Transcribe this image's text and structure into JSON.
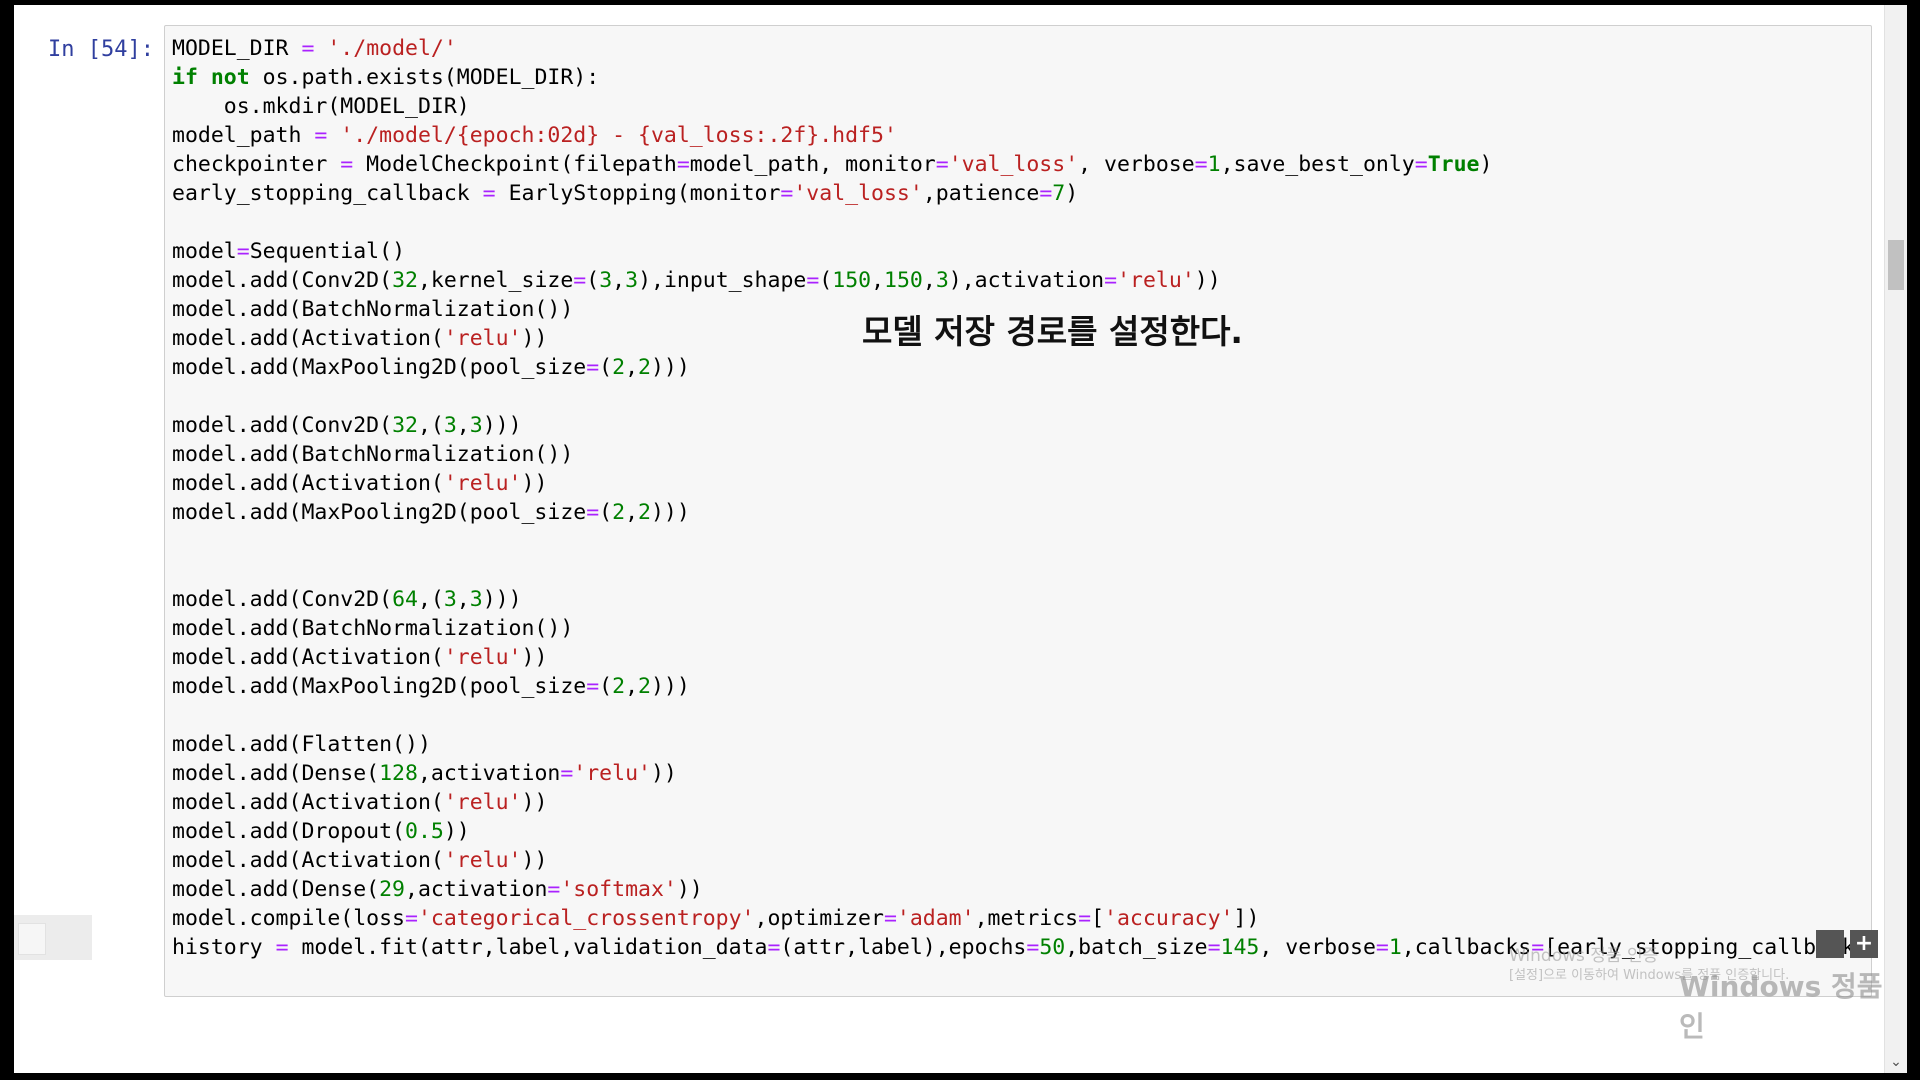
{
  "cell": {
    "prompt": "In [54]:",
    "lines": [
      [
        {
          "t": "MODEL_DIR "
        },
        {
          "t": "=",
          "c": "o"
        },
        {
          "t": " "
        },
        {
          "t": "'./model/'",
          "c": "s"
        }
      ],
      [
        {
          "t": "if",
          "c": "k"
        },
        {
          "t": " "
        },
        {
          "t": "not",
          "c": "k"
        },
        {
          "t": " os.path.exists(MODEL_DIR):"
        }
      ],
      [
        {
          "t": "    os.mkdir(MODEL_DIR)"
        }
      ],
      [
        {
          "t": "model_path "
        },
        {
          "t": "=",
          "c": "o"
        },
        {
          "t": " "
        },
        {
          "t": "'./model/{epoch:02d} - {val_loss:.2f}.hdf5'",
          "c": "s"
        }
      ],
      [
        {
          "t": "checkpointer "
        },
        {
          "t": "=",
          "c": "o"
        },
        {
          "t": " ModelCheckpoint(filepath"
        },
        {
          "t": "=",
          "c": "o"
        },
        {
          "t": "model_path, monitor"
        },
        {
          "t": "=",
          "c": "o"
        },
        {
          "t": "'val_loss'",
          "c": "s"
        },
        {
          "t": ", verbose"
        },
        {
          "t": "=",
          "c": "o"
        },
        {
          "t": "1",
          "c": "n"
        },
        {
          "t": ",save_best_only"
        },
        {
          "t": "=",
          "c": "o"
        },
        {
          "t": "True",
          "c": "k"
        },
        {
          "t": ")"
        }
      ],
      [
        {
          "t": "early_stopping_callback "
        },
        {
          "t": "=",
          "c": "o"
        },
        {
          "t": " EarlyStopping(monitor"
        },
        {
          "t": "=",
          "c": "o"
        },
        {
          "t": "'val_loss'",
          "c": "s"
        },
        {
          "t": ",patience"
        },
        {
          "t": "=",
          "c": "o"
        },
        {
          "t": "7",
          "c": "n"
        },
        {
          "t": ")"
        }
      ],
      [],
      [
        {
          "t": "model"
        },
        {
          "t": "=",
          "c": "o"
        },
        {
          "t": "Sequential()"
        }
      ],
      [
        {
          "t": "model.add(Conv2D("
        },
        {
          "t": "32",
          "c": "n"
        },
        {
          "t": ",kernel_size"
        },
        {
          "t": "=",
          "c": "o"
        },
        {
          "t": "("
        },
        {
          "t": "3",
          "c": "n"
        },
        {
          "t": ","
        },
        {
          "t": "3",
          "c": "n"
        },
        {
          "t": "),input_shape"
        },
        {
          "t": "=",
          "c": "o"
        },
        {
          "t": "("
        },
        {
          "t": "150",
          "c": "n"
        },
        {
          "t": ","
        },
        {
          "t": "150",
          "c": "n"
        },
        {
          "t": ","
        },
        {
          "t": "3",
          "c": "n"
        },
        {
          "t": "),activation"
        },
        {
          "t": "=",
          "c": "o"
        },
        {
          "t": "'relu'",
          "c": "s"
        },
        {
          "t": "))"
        }
      ],
      [
        {
          "t": "model.add(BatchNormalization())"
        }
      ],
      [
        {
          "t": "model.add(Activation("
        },
        {
          "t": "'relu'",
          "c": "s"
        },
        {
          "t": "))"
        }
      ],
      [
        {
          "t": "model.add(MaxPooling2D(pool_size"
        },
        {
          "t": "=",
          "c": "o"
        },
        {
          "t": "("
        },
        {
          "t": "2",
          "c": "n"
        },
        {
          "t": ","
        },
        {
          "t": "2",
          "c": "n"
        },
        {
          "t": ")))"
        }
      ],
      [],
      [
        {
          "t": "model.add(Conv2D("
        },
        {
          "t": "32",
          "c": "n"
        },
        {
          "t": ",("
        },
        {
          "t": "3",
          "c": "n"
        },
        {
          "t": ","
        },
        {
          "t": "3",
          "c": "n"
        },
        {
          "t": ")))"
        }
      ],
      [
        {
          "t": "model.add(BatchNormalization())"
        }
      ],
      [
        {
          "t": "model.add(Activation("
        },
        {
          "t": "'relu'",
          "c": "s"
        },
        {
          "t": "))"
        }
      ],
      [
        {
          "t": "model.add(MaxPooling2D(pool_size"
        },
        {
          "t": "=",
          "c": "o"
        },
        {
          "t": "("
        },
        {
          "t": "2",
          "c": "n"
        },
        {
          "t": ","
        },
        {
          "t": "2",
          "c": "n"
        },
        {
          "t": ")))"
        }
      ],
      [],
      [],
      [
        {
          "t": "model.add(Conv2D("
        },
        {
          "t": "64",
          "c": "n"
        },
        {
          "t": ",("
        },
        {
          "t": "3",
          "c": "n"
        },
        {
          "t": ","
        },
        {
          "t": "3",
          "c": "n"
        },
        {
          "t": ")))"
        }
      ],
      [
        {
          "t": "model.add(BatchNormalization())"
        }
      ],
      [
        {
          "t": "model.add(Activation("
        },
        {
          "t": "'relu'",
          "c": "s"
        },
        {
          "t": "))"
        }
      ],
      [
        {
          "t": "model.add(MaxPooling2D(pool_size"
        },
        {
          "t": "=",
          "c": "o"
        },
        {
          "t": "("
        },
        {
          "t": "2",
          "c": "n"
        },
        {
          "t": ","
        },
        {
          "t": "2",
          "c": "n"
        },
        {
          "t": ")))"
        }
      ],
      [],
      [
        {
          "t": "model.add(Flatten())"
        }
      ],
      [
        {
          "t": "model.add(Dense("
        },
        {
          "t": "128",
          "c": "n"
        },
        {
          "t": ",activation"
        },
        {
          "t": "=",
          "c": "o"
        },
        {
          "t": "'relu'",
          "c": "s"
        },
        {
          "t": "))"
        }
      ],
      [
        {
          "t": "model.add(Activation("
        },
        {
          "t": "'relu'",
          "c": "s"
        },
        {
          "t": "))"
        }
      ],
      [
        {
          "t": "model.add(Dropout("
        },
        {
          "t": "0.5",
          "c": "n"
        },
        {
          "t": "))"
        }
      ],
      [
        {
          "t": "model.add(Activation("
        },
        {
          "t": "'relu'",
          "c": "s"
        },
        {
          "t": "))"
        }
      ],
      [
        {
          "t": "model.add(Dense("
        },
        {
          "t": "29",
          "c": "n"
        },
        {
          "t": ",activation"
        },
        {
          "t": "=",
          "c": "o"
        },
        {
          "t": "'softmax'",
          "c": "s"
        },
        {
          "t": "))"
        }
      ],
      [
        {
          "t": "model.compile(loss"
        },
        {
          "t": "=",
          "c": "o"
        },
        {
          "t": "'categorical_crossentropy'",
          "c": "s"
        },
        {
          "t": ",optimizer"
        },
        {
          "t": "=",
          "c": "o"
        },
        {
          "t": "'adam'",
          "c": "s"
        },
        {
          "t": ",metrics"
        },
        {
          "t": "=",
          "c": "o"
        },
        {
          "t": "["
        },
        {
          "t": "'accuracy'",
          "c": "s"
        },
        {
          "t": "])"
        }
      ],
      [
        {
          "t": "history "
        },
        {
          "t": "=",
          "c": "o"
        },
        {
          "t": " model.fit(attr,label,validation_data"
        },
        {
          "t": "=",
          "c": "o"
        },
        {
          "t": "(attr,label),epochs"
        },
        {
          "t": "=",
          "c": "o"
        },
        {
          "t": "50",
          "c": "n"
        },
        {
          "t": ",batch_size"
        },
        {
          "t": "=",
          "c": "o"
        },
        {
          "t": "145",
          "c": "n"
        },
        {
          "t": ", verbose"
        },
        {
          "t": "=",
          "c": "o"
        },
        {
          "t": "1",
          "c": "n"
        },
        {
          "t": ",callbacks"
        },
        {
          "t": "=",
          "c": "o"
        },
        {
          "t": "[early_stopping_callback,check"
        }
      ]
    ]
  },
  "annotation": "모델 저장 경로를 설정한다.",
  "buttons": {
    "plus": "+"
  },
  "scrollbar": {
    "down_arrow": "⌄"
  },
  "watermark": {
    "title": "Windows 정품 인증",
    "subtitle": "[설정]으로 이동하여 Windows를 정품 인증합니다.",
    "big": "Windows 정품 인"
  },
  "colors": {
    "keyword": "#008000",
    "string": "#ba2121",
    "number": "#008000",
    "operator": "#aa22ff",
    "prompt": "#303f9f"
  }
}
